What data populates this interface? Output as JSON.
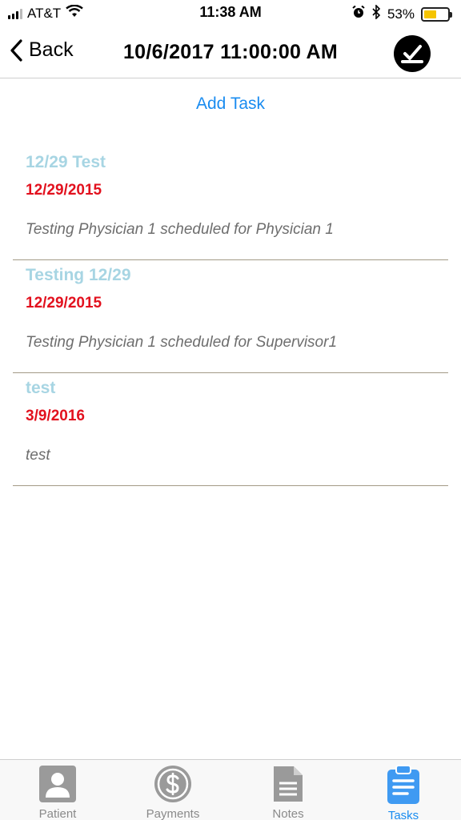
{
  "status_bar": {
    "carrier": "AT&T",
    "time": "11:38 AM",
    "battery_percent": "53%",
    "battery_level": 0.53,
    "icons": [
      "signal-icon",
      "wifi-icon",
      "alarm-icon",
      "bluetooth-icon",
      "battery-icon"
    ]
  },
  "nav": {
    "back_label": "Back",
    "title": "10/6/2017 11:00:00 AM"
  },
  "add_task_label": "Add Task",
  "tasks": [
    {
      "title": "12/29 Test",
      "date": "12/29/2015",
      "description": "Testing Physician 1 scheduled for Physician 1"
    },
    {
      "title": "Testing 12/29",
      "date": "12/29/2015",
      "description": "Testing Physician 1 scheduled for Supervisor1"
    },
    {
      "title": "test",
      "date": "3/9/2016",
      "description": "test"
    }
  ],
  "tabs": [
    {
      "label": "Patient",
      "icon": "patient-icon",
      "active": false
    },
    {
      "label": "Payments",
      "icon": "dollar-icon",
      "active": false
    },
    {
      "label": "Notes",
      "icon": "notes-icon",
      "active": false
    },
    {
      "label": "Tasks",
      "icon": "clipboard-icon",
      "active": true
    }
  ],
  "colors": {
    "accent": "#1a8cf0",
    "task_title": "#a7d5e3",
    "task_date": "#e2111e",
    "battery": "#f5c400"
  }
}
